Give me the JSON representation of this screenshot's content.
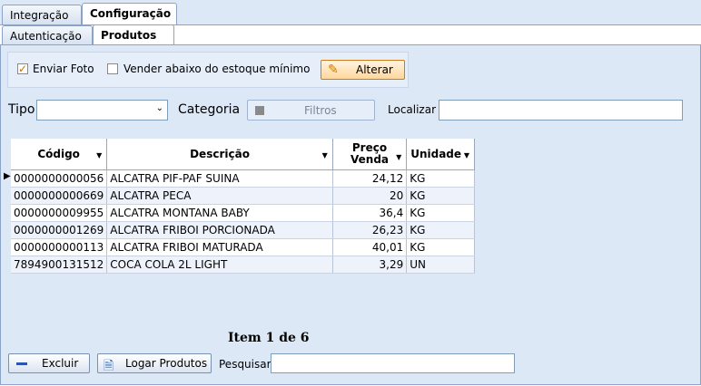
{
  "tabs_outer": [
    "Integração",
    "Configuração"
  ],
  "tabs_inner": [
    "Autenticação",
    "Produtos"
  ],
  "options": {
    "enviar_foto": {
      "label": "Enviar Foto",
      "checked": true
    },
    "vender_abaixo": {
      "label": "Vender abaixo do estoque mínimo",
      "checked": false
    },
    "alterar_label": "Alterar"
  },
  "filters": {
    "tipo_label": "Tipo",
    "tipo_value": "",
    "categoria_label": "Categoria",
    "filtros_label": "Filtros",
    "localizar_label": "Localizar",
    "localizar_value": ""
  },
  "table": {
    "columns": [
      "Código",
      "Descrição",
      "Preço Venda",
      "Unidade"
    ],
    "rows": [
      [
        "0000000000056",
        "ALCATRA PIF-PAF SUINA",
        "24,12",
        "KG"
      ],
      [
        "0000000000669",
        "ALCATRA PECA",
        "20",
        "KG"
      ],
      [
        "0000000009955",
        "ALCATRA MONTANA BABY",
        "36,4",
        "KG"
      ],
      [
        "0000000001269",
        "ALCATRA FRIBOI PORCIONADA",
        "26,23",
        "KG"
      ],
      [
        "0000000000113",
        "ALCATRA FRIBOI MATURADA",
        "40,01",
        "KG"
      ],
      [
        "7894900131512",
        "COCA COLA 2L LIGHT",
        "3,29",
        "UN"
      ]
    ]
  },
  "item_count": "Item 1 de 6",
  "footer": {
    "excluir_label": "Excluir",
    "logar_label": "Logar Produtos",
    "pesquisar_label": "Pesquisar",
    "pesquisar_value": ""
  },
  "colors": {
    "background": "#dde8f7",
    "accent": "#d46a00"
  }
}
